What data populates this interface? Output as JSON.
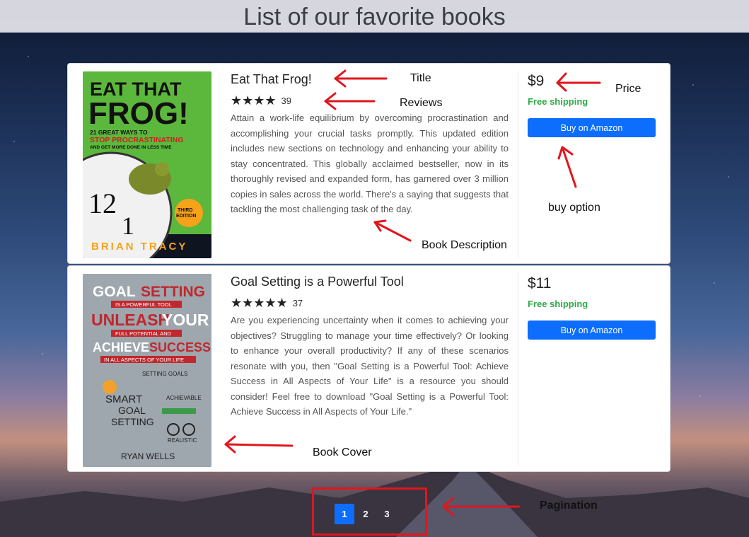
{
  "header": {
    "title": "List of our favorite books"
  },
  "books": [
    {
      "cover": {
        "line1": "EAT THAT",
        "line2": "FROG!",
        "tagline1": "21 GREAT WAYS TO",
        "tagline2": "STOP PROCRASTINATING",
        "tagline3": "AND GET MORE DONE IN LESS TIME",
        "badge1": "THIRD",
        "badge2": "EDITION",
        "author": "BRIAN TRACY"
      },
      "title": "Eat That Frog!",
      "stars": "★★★★",
      "reviews": "39",
      "description": "Attain a work-life equilibrium by overcoming procrastination and accomplishing your crucial tasks promptly. This updated edition includes new sections on technology and enhancing your ability to stay concentrated. This globally acclaimed bestseller, now in its thoroughly revised and expanded form, has garnered over 3 million copies in sales across the world. There's a saying that suggests that tackling the most challenging task of the day.",
      "price": "$9",
      "shipping": "Free shipping",
      "buy_label": "Buy on Amazon"
    },
    {
      "cover": {
        "line1": "GOAL",
        "line1b": "SETTING",
        "small1": "IS A POWERFUL TOOL",
        "line2": "UNLEASH",
        "line2b": "YOUR",
        "small2": "FULL POTENTIAL AND",
        "line3": "ACHIEVE",
        "line3b": "SUCCESS",
        "small3": "IN ALL ASPECTS OF YOUR LIFE",
        "doodle1": "SETTING GOALS",
        "doodle2": "SMART",
        "doodle3": "GOAL",
        "doodle4": "SETTING",
        "doodle5": "ACHIEVABLE",
        "doodle6": "REALISTIC",
        "author": "RYAN WELLS"
      },
      "title": "Goal Setting is a Powerful Tool",
      "stars": "★★★★★",
      "reviews": "37",
      "description": "Are you experiencing uncertainty when it comes to achieving your objectives? Struggling to manage your time effectively? Or looking to enhance your overall productivity? If any of these scenarios resonate with you, then \"Goal Setting is a Powerful Tool: Achieve Success in All Aspects of Your Life\" is a resource you should consider! Feel free to download \"Goal Setting is a Powerful Tool: Achieve Success in All Aspects of Your Life.\"",
      "price": "$11",
      "shipping": "Free shipping",
      "buy_label": "Buy on Amazon"
    }
  ],
  "pagination": {
    "pages": [
      "1",
      "2",
      "3"
    ],
    "active_page": "1"
  },
  "annotations": {
    "title": "Title",
    "reviews": "Reviews",
    "price": "Price",
    "buy_option": "buy option",
    "book_description": "Book Description",
    "book_cover": "Book Cover",
    "pagination": "Pagination"
  },
  "colors": {
    "accent": "#0d6efd",
    "shipping": "#2eaa4a",
    "annotation": "#e0161e"
  }
}
